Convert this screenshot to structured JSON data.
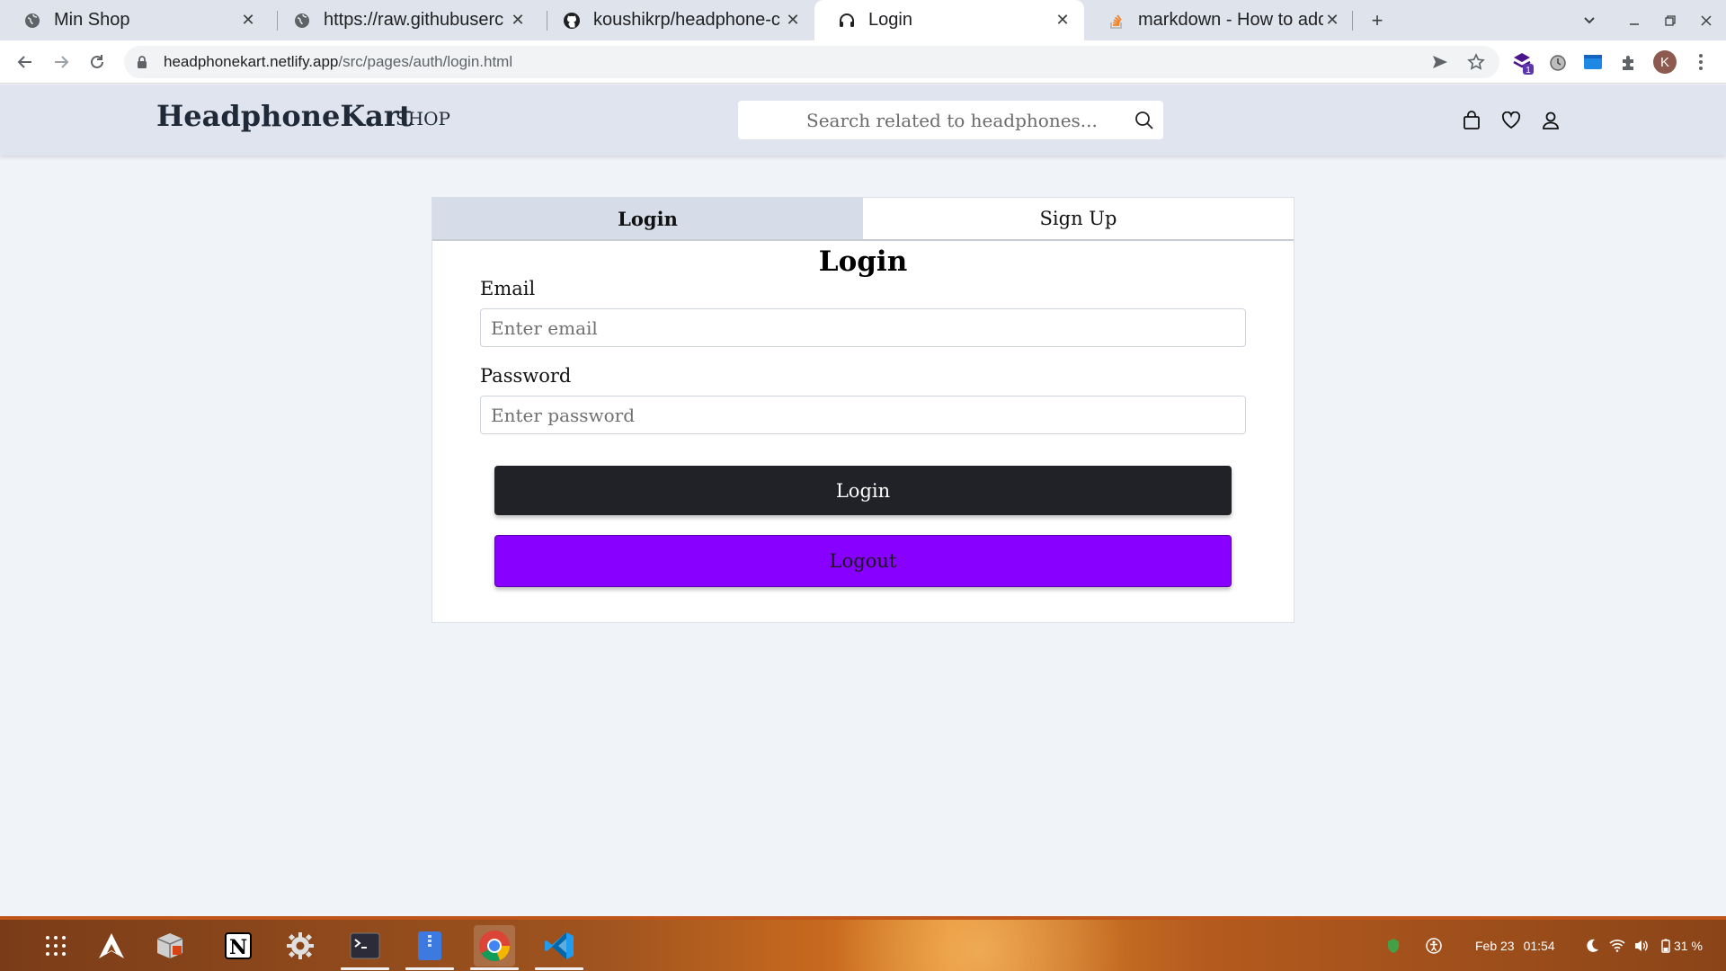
{
  "browser": {
    "tabs": [
      {
        "title": "Min Shop",
        "icon": "globe-icon"
      },
      {
        "title": "https://raw.githubuserc",
        "icon": "globe-icon"
      },
      {
        "title": "koushikrp/headphone-c",
        "icon": "github-icon"
      },
      {
        "title": "Login",
        "icon": "headphones-icon"
      },
      {
        "title": "markdown - How to add",
        "icon": "stackoverflow-icon"
      }
    ],
    "close_glyph": "✕",
    "new_tab_glyph": "+",
    "url_host": "headphonekart.netlify.app",
    "url_path": "/src/pages/auth/login.html",
    "profile_initial": "K",
    "ext_badge": "1"
  },
  "header": {
    "brand": "HeadphoneKart",
    "shop_link": "SHOP",
    "search_placeholder": "Search related to headphones..."
  },
  "auth": {
    "tab_login": "Login",
    "tab_signup": "Sign Up",
    "heading": "Login",
    "email_label": "Email",
    "email_placeholder": "Enter email",
    "password_label": "Password",
    "password_placeholder": "Enter password",
    "login_button": "Login",
    "logout_button": "Logout"
  },
  "taskbar": {
    "date": "Feb 23",
    "time": "01:54",
    "battery": "31 %"
  },
  "colors": {
    "logout_purple": "#8800ff",
    "login_dark": "#202227",
    "header_bg": "#dfe4ee"
  }
}
